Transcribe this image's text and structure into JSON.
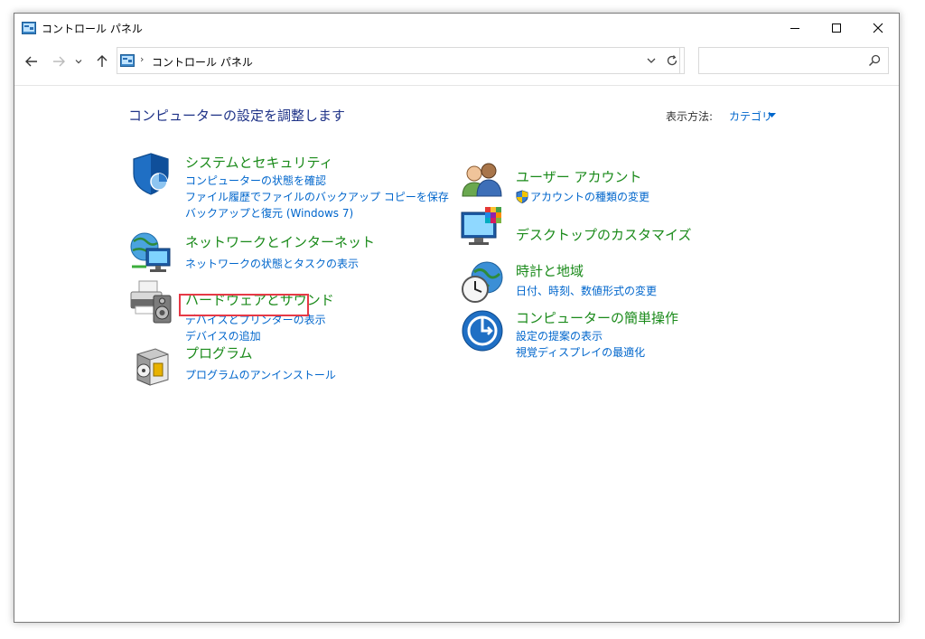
{
  "window": {
    "title": "コントロール パネル"
  },
  "address": {
    "crumb": "コントロール パネル",
    "separator": "›",
    "search_placeholder": ""
  },
  "content": {
    "heading": "コンピューターの設定を調整します",
    "view_by_label": "表示方法:",
    "view_by_value": "カテゴリ"
  },
  "categories": {
    "system": {
      "title": "システムとセキュリティ",
      "links": [
        "コンピューターの状態を確認",
        "ファイル履歴でファイルのバックアップ コピーを保存",
        "バックアップと復元 (Windows 7)"
      ]
    },
    "network": {
      "title": "ネットワークとインターネット",
      "links": [
        "ネットワークの状態とタスクの表示"
      ]
    },
    "hardware": {
      "title": "ハードウェアとサウンド",
      "links": [
        "デバイスとプリンターの表示",
        "デバイスの追加"
      ]
    },
    "programs": {
      "title": "プログラム",
      "links": [
        "プログラムのアンインストール"
      ]
    },
    "user": {
      "title": "ユーザー アカウント",
      "links": [
        "アカウントの種類の変更"
      ]
    },
    "desktop": {
      "title": "デスクトップのカスタマイズ",
      "links": []
    },
    "clock": {
      "title": "時計と地域",
      "links": [
        "日付、時刻、数値形式の変更"
      ]
    },
    "access": {
      "title": "コンピューターの簡単操作",
      "links": [
        "設定の提案の表示",
        "視覚ディスプレイの最適化"
      ]
    }
  },
  "colors": {
    "category_title": "#1a8a1a",
    "link": "#0066cc",
    "heading": "#1e3287",
    "highlight": "#e63946"
  },
  "icons": {
    "titlebar": "control-panel-icon",
    "system": "shield-icon",
    "network": "network-globe-icon",
    "hardware": "printer-speaker-icon",
    "programs": "program-box-icon",
    "user": "users-icon",
    "desktop": "monitor-color-icon",
    "clock": "clock-globe-icon",
    "access": "ease-of-access-icon"
  }
}
